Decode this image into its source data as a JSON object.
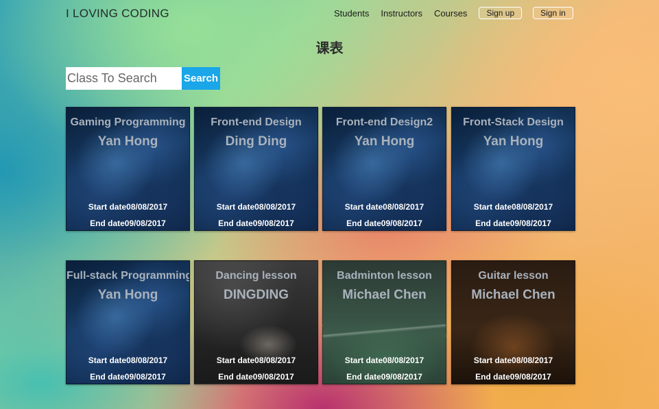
{
  "header": {
    "brand": "I LOVING CODING",
    "nav": {
      "students": "Students",
      "instructors": "Instructors",
      "courses": "Courses",
      "signup": "Sign up",
      "signin": "Sign in"
    }
  },
  "page": {
    "title": "课表"
  },
  "search": {
    "placeholder": "Class To Search",
    "button_label": "Search"
  },
  "courses": [
    {
      "title": "Gaming Programming",
      "teacher": "Yan Hong",
      "start": "Start date08/08/2017",
      "end": "End date09/08/2017",
      "image": "space-nebula"
    },
    {
      "title": "Front-end Design",
      "teacher": "Ding Ding",
      "start": "Start date08/08/2017",
      "end": "End date09/08/2017",
      "image": "space-nebula"
    },
    {
      "title": "Front-end Design2",
      "teacher": "Yan Hong",
      "start": "Start date08/08/2017",
      "end": "End date09/08/2017",
      "image": "space-nebula"
    },
    {
      "title": "Front-Stack Design",
      "teacher": "Yan Hong",
      "start": "Start date08/08/2017",
      "end": "End date09/08/2017",
      "image": "space-nebula"
    },
    {
      "title": "Full-stack Programming",
      "teacher": "Yan Hong",
      "start": "Start date08/08/2017",
      "end": "End date09/08/2017",
      "image": "space-nebula"
    },
    {
      "title": "Dancing lesson",
      "teacher": "DINGDING",
      "start": "Start date08/08/2017",
      "end": "End date09/08/2017",
      "image": "dancer"
    },
    {
      "title": "Badminton lesson",
      "teacher": "Michael Chen",
      "start": "Start date08/08/2017",
      "end": "End date09/08/2017",
      "image": "badminton-racket"
    },
    {
      "title": "Guitar lesson",
      "teacher": "Michael Chen",
      "start": "Start date08/08/2017",
      "end": "End date09/08/2017",
      "image": "guitar"
    }
  ],
  "colors": {
    "search_button": "#1aa6e8",
    "card_text": "#a9b2bc"
  }
}
